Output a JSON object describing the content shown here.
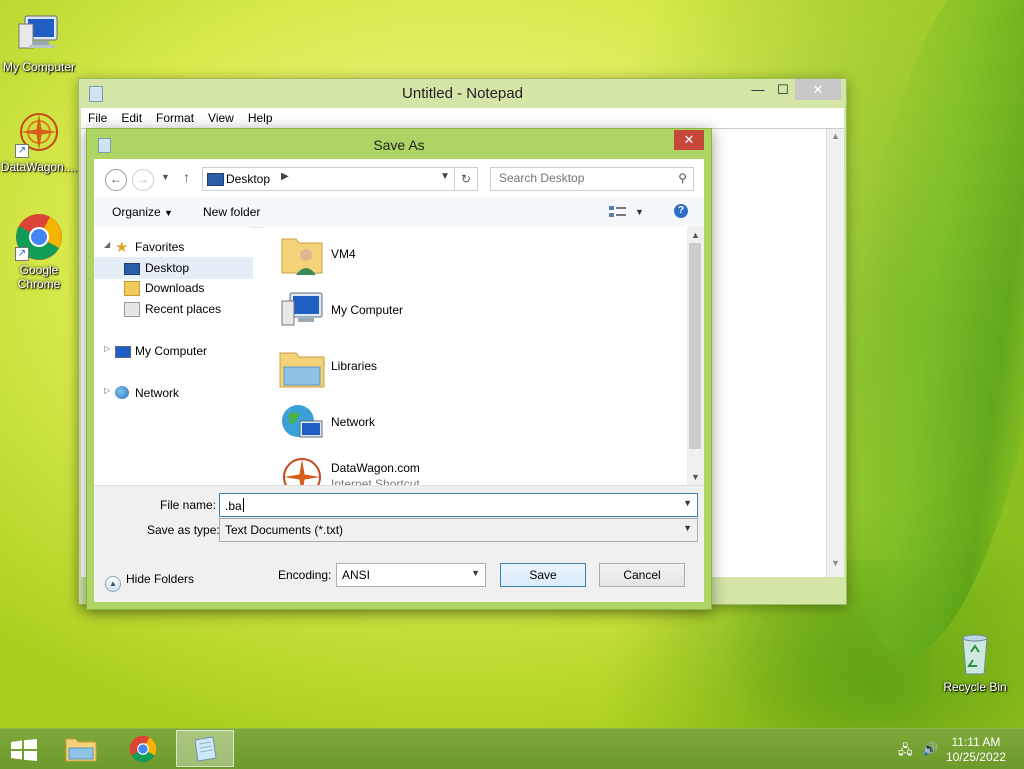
{
  "desktop": {
    "icons": [
      {
        "label": "My Computer"
      },
      {
        "label": "DataWagon...."
      },
      {
        "label": "Google Chrome"
      },
      {
        "label": "Recycle Bin"
      }
    ]
  },
  "notepad": {
    "title": "Untitled - Notepad",
    "controls": {
      "minimize": "—",
      "maximize": "☐",
      "close": "✕"
    },
    "menu": [
      "File",
      "Edit",
      "Format",
      "View",
      "Help"
    ]
  },
  "dialog": {
    "title": "Save As",
    "close": "✕",
    "address": {
      "location": "Desktop"
    },
    "search": {
      "placeholder": "Search Desktop"
    },
    "toolbar": {
      "organize": "Organize",
      "new_folder": "New folder",
      "help": "?"
    },
    "nav": {
      "favorites": "Favorites",
      "desktop": "Desktop",
      "downloads": "Downloads",
      "recent": "Recent places",
      "my_computer": "My Computer",
      "network": "Network"
    },
    "files": [
      {
        "name": "VM4",
        "sub": ""
      },
      {
        "name": "My Computer",
        "sub": ""
      },
      {
        "name": "Libraries",
        "sub": ""
      },
      {
        "name": "Network",
        "sub": ""
      },
      {
        "name": "DataWagon.com",
        "sub": "Internet Shortcut"
      }
    ],
    "form": {
      "file_name_label": "File name:",
      "file_name_value": ".ba",
      "type_label": "Save as type:",
      "type_value": "Text Documents (*.txt)",
      "encoding_label": "Encoding:",
      "encoding_value": "ANSI",
      "save": "Save",
      "cancel": "Cancel",
      "hide_folders": "Hide Folders"
    }
  },
  "taskbar": {
    "time": "11:11 AM",
    "date": "10/25/2022"
  }
}
